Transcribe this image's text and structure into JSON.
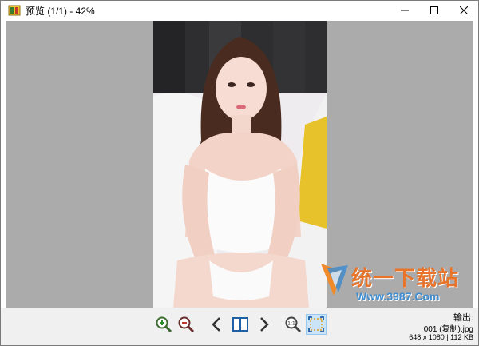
{
  "window": {
    "title": "预览 (1/1) - 42%",
    "controls": [
      "minimize-icon",
      "maximize-icon",
      "close-icon"
    ]
  },
  "preview": {
    "background": "#ababab",
    "image_description_icon": "photo"
  },
  "watermark": {
    "title": "统一下载站",
    "url": "Www.3987.Com"
  },
  "toolbar": {
    "buttons": [
      {
        "name": "zoom-in",
        "icon": "zoom-in-icon"
      },
      {
        "name": "zoom-out",
        "icon": "zoom-out-icon"
      },
      {
        "name": "previous",
        "icon": "chevron-left-icon"
      },
      {
        "name": "split-view",
        "icon": "split-view-icon"
      },
      {
        "name": "next",
        "icon": "chevron-right-icon"
      },
      {
        "name": "actual-size",
        "icon": "zoom-1to1-icon"
      },
      {
        "name": "fit-window",
        "icon": "fit-window-icon",
        "active": true
      }
    ]
  },
  "status": {
    "output_label": "输出:",
    "file_name": "001 (复制).jpg",
    "info": "648 x 1080  |  112 KB"
  }
}
